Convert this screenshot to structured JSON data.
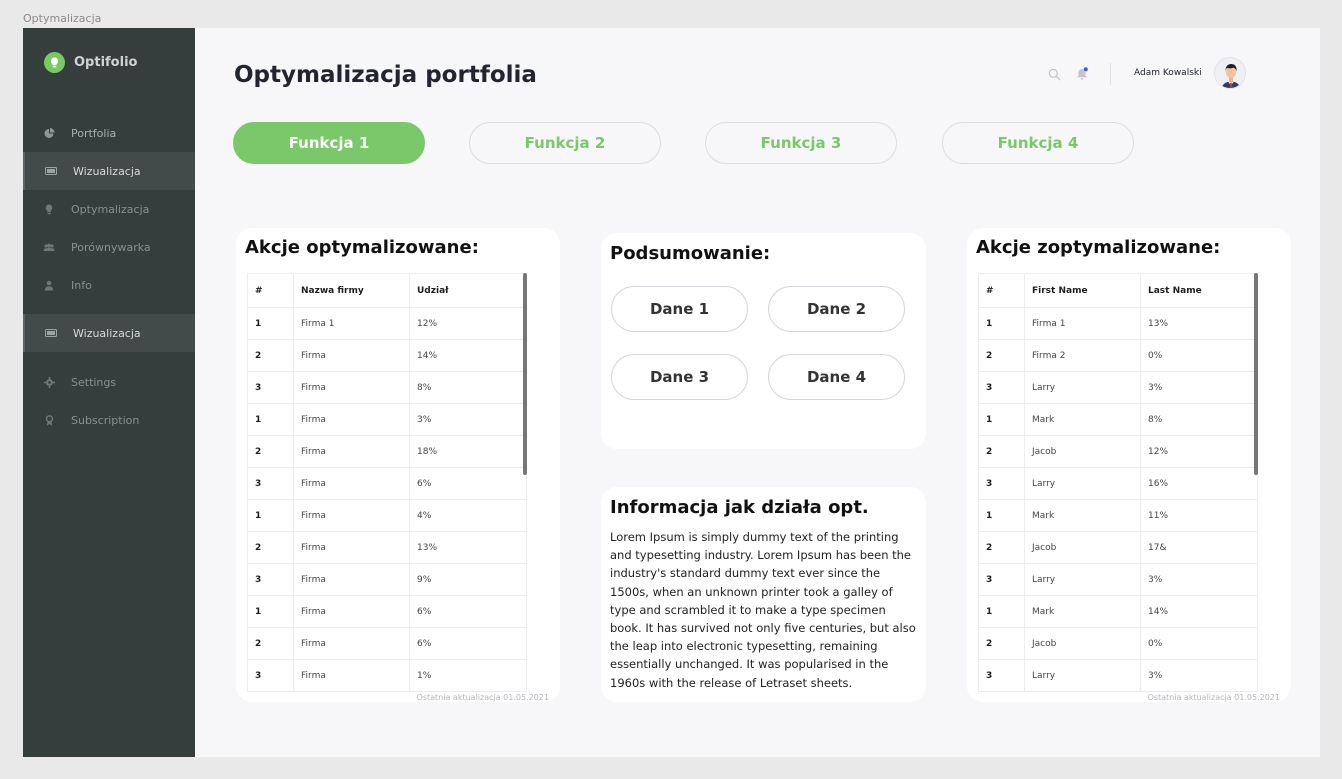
{
  "frame_label": "Optymalizacja",
  "brand": {
    "name": "Optifolio"
  },
  "sidebar": {
    "items": [
      {
        "label": "Portfolia",
        "icon": "pie-chart-icon"
      },
      {
        "label": "Wizualizacja",
        "icon": "monitor-icon",
        "active": true
      },
      {
        "label": "Optymalizacja",
        "icon": "lightbulb-icon"
      },
      {
        "label": "Porównywarka",
        "icon": "users-icon"
      },
      {
        "label": "Info",
        "icon": "user-icon"
      },
      {
        "label": "Wizualizacja",
        "icon": "monitor-icon",
        "active": true
      },
      {
        "label": "Settings",
        "icon": "gear-icon"
      },
      {
        "label": "Subscription",
        "icon": "badge-icon"
      }
    ]
  },
  "header": {
    "title": "Optymalizacja portfolia",
    "user_name": "Adam Kowalski"
  },
  "tabs": [
    {
      "label": "Funkcja 1",
      "active": true
    },
    {
      "label": "Funkcja 2",
      "active": false
    },
    {
      "label": "Funkcja 3",
      "active": false
    },
    {
      "label": "Funkcja 4",
      "active": false
    }
  ],
  "left_card": {
    "title": "Akcje optymalizowane:",
    "columns": [
      "#",
      "Nazwa firmy",
      "Udział"
    ],
    "rows": [
      [
        "1",
        "Firma 1",
        "12%"
      ],
      [
        "2",
        "Firma",
        "14%"
      ],
      [
        "3",
        "Firma",
        "8%"
      ],
      [
        "1",
        "Firma",
        "3%"
      ],
      [
        "2",
        "Firma",
        "18%"
      ],
      [
        "3",
        "Firma",
        "6%"
      ],
      [
        "1",
        "Firma",
        "4%"
      ],
      [
        "2",
        "Firma",
        "13%"
      ],
      [
        "3",
        "Firma",
        "9%"
      ],
      [
        "1",
        "Firma",
        "6%"
      ],
      [
        "2",
        "Firma",
        "6%"
      ],
      [
        "3",
        "Firma",
        "1%"
      ]
    ],
    "update_note": "Ostatnia aktualizacja 01.05.2021"
  },
  "summary_card": {
    "title": "Podsumowanie:",
    "buttons": [
      "Dane 1",
      "Dane 2",
      "Dane 3",
      "Dane 4"
    ]
  },
  "info_card": {
    "title": "Informacja jak działa opt.",
    "text": "Lorem Ipsum is simply dummy text of the printing and typesetting industry. Lorem Ipsum has been the industry's standard dummy text ever since the 1500s, when an unknown printer took a galley of type and scrambled it to make a type specimen book. It has survived not only five centuries, but also the leap into electronic typesetting, remaining essentially unchanged. It was popularised in the 1960s with the release of Letraset sheets."
  },
  "right_card": {
    "title": "Akcje zoptymalizowane:",
    "columns": [
      "#",
      "First Name",
      "Last Name"
    ],
    "rows": [
      [
        "1",
        "Firma 1",
        "13%"
      ],
      [
        "2",
        "Firma 2",
        "0%"
      ],
      [
        "3",
        "Larry",
        "3%"
      ],
      [
        "1",
        "Mark",
        "8%"
      ],
      [
        "2",
        "Jacob",
        "12%"
      ],
      [
        "3",
        "Larry",
        "16%"
      ],
      [
        "1",
        "Mark",
        "11%"
      ],
      [
        "2",
        "Jacob",
        "17&"
      ],
      [
        "3",
        "Larry",
        "3%"
      ],
      [
        "1",
        "Mark",
        "14%"
      ],
      [
        "2",
        "Jacob",
        "0%"
      ],
      [
        "3",
        "Larry",
        "3%"
      ]
    ],
    "update_note": "Ostatnia aktualizacja 01.05.2021"
  },
  "colors": {
    "accent": "#7ac86a",
    "sidebar_bg": "#353d3d",
    "sidebar_active": "#424a4a",
    "main_bg": "#f7f7f9"
  }
}
